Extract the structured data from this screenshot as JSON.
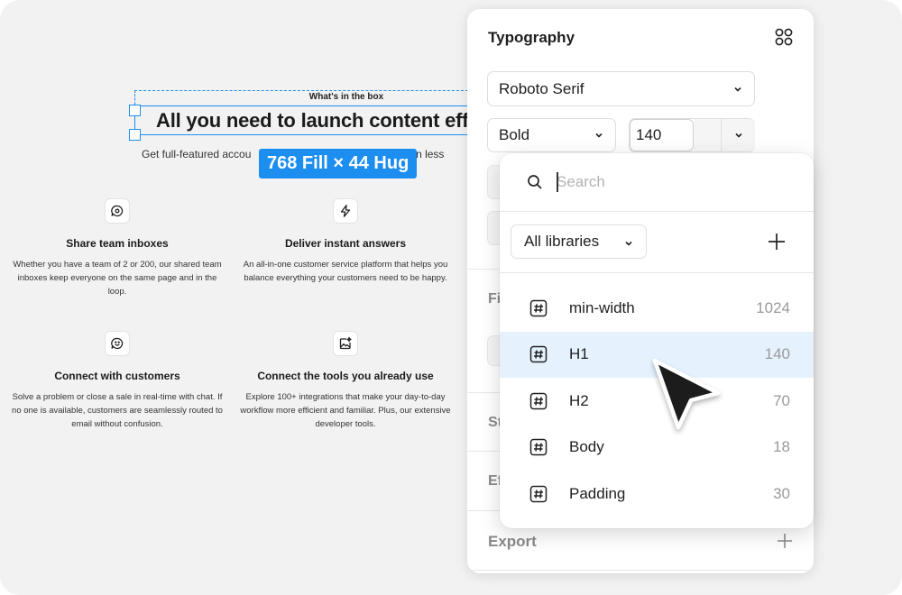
{
  "canvas": {
    "kicker": "What's in the box",
    "headline": "All you need to launch content effe",
    "subline_left": "Get full-featured accou",
    "subline_right": "in less",
    "size_badge": "768 Fill × 44 Hug",
    "features": [
      {
        "icon": "chat-bubble-icon",
        "title": "Share team inboxes",
        "desc": "Whether you have a team of 2 or 200, our shared team inboxes keep everyone on the same page and in the loop."
      },
      {
        "icon": "lightning-icon",
        "title": "Deliver instant answers",
        "desc": "An all-in-one customer service platform that helps you balance everything your customers need to be happy."
      },
      {
        "icon": "smile-chat-icon",
        "title": "Connect with customers",
        "desc": "Solve a problem or close a sale in real-time with chat. If no one is available, customers are seamlessly routed to email without confusion."
      },
      {
        "icon": "image-sparkle-icon",
        "title": "Connect the tools you already use",
        "desc": "Explore 100+ integrations that make your day-to-day workflow more efficient and familiar. Plus, our extensive developer tools."
      }
    ]
  },
  "panel": {
    "title": "Typography",
    "font_family": "Roboto Serif",
    "font_weight": "Bold",
    "font_size": "140",
    "ghost_fi": "Fi",
    "ghost_st": "St",
    "ghost_ef": "Ef",
    "export": "Export"
  },
  "dropdown": {
    "search_placeholder": "Search",
    "libraries": "All libraries",
    "items": [
      {
        "name": "min-width",
        "value": "1024",
        "active": false
      },
      {
        "name": "H1",
        "value": "140",
        "active": true
      },
      {
        "name": "H2",
        "value": "70",
        "active": false
      },
      {
        "name": "Body",
        "value": "18",
        "active": false
      },
      {
        "name": "Padding",
        "value": "30",
        "active": false
      }
    ]
  },
  "colors": {
    "selection": "#1c8ef0",
    "active_row": "#e5f2fd",
    "canvas_bg": "#f2f2f2"
  }
}
